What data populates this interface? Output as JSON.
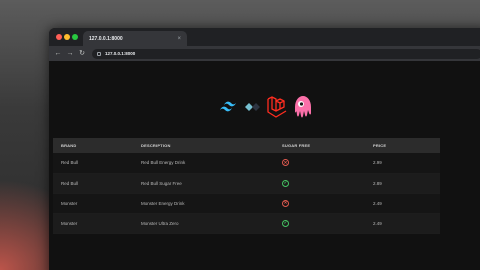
{
  "browser": {
    "tab_title": "127.0.0.1:8000",
    "tab_close": "×",
    "url": "127.0.0.1:8000",
    "back_glyph": "←",
    "forward_glyph": "→",
    "reload_glyph": "↻"
  },
  "logos": [
    "tailwind-logo",
    "alpine-logo",
    "laravel-logo",
    "livewire-logo"
  ],
  "table": {
    "headers": [
      "BRAND",
      "DESCRIPTION",
      "SUGAR FREE",
      "PRICE"
    ],
    "rows": [
      {
        "brand": "Red Bull",
        "description": "Red Bull Energy Drink",
        "sugar_free": "no",
        "sugar_glyph": "✕",
        "price": "2.99"
      },
      {
        "brand": "Red Bull",
        "description": "Red Bull Sugar Free",
        "sugar_free": "yes",
        "sugar_glyph": "✓",
        "price": "2.89"
      },
      {
        "brand": "Monster",
        "description": "Monster Energy Drink",
        "sugar_free": "no",
        "sugar_glyph": "✕",
        "price": "2.49"
      },
      {
        "brand": "Monster",
        "description": "Monster Ultra Zero",
        "sugar_free": "yes",
        "sugar_glyph": "✓",
        "price": "2.49"
      }
    ]
  },
  "colors": {
    "sugar_free_yes": "#45c463",
    "sugar_free_no": "#e05a4f",
    "laravel": "#ff2d20",
    "tailwind": "#38bdf8",
    "livewire": "#fb70a9"
  }
}
